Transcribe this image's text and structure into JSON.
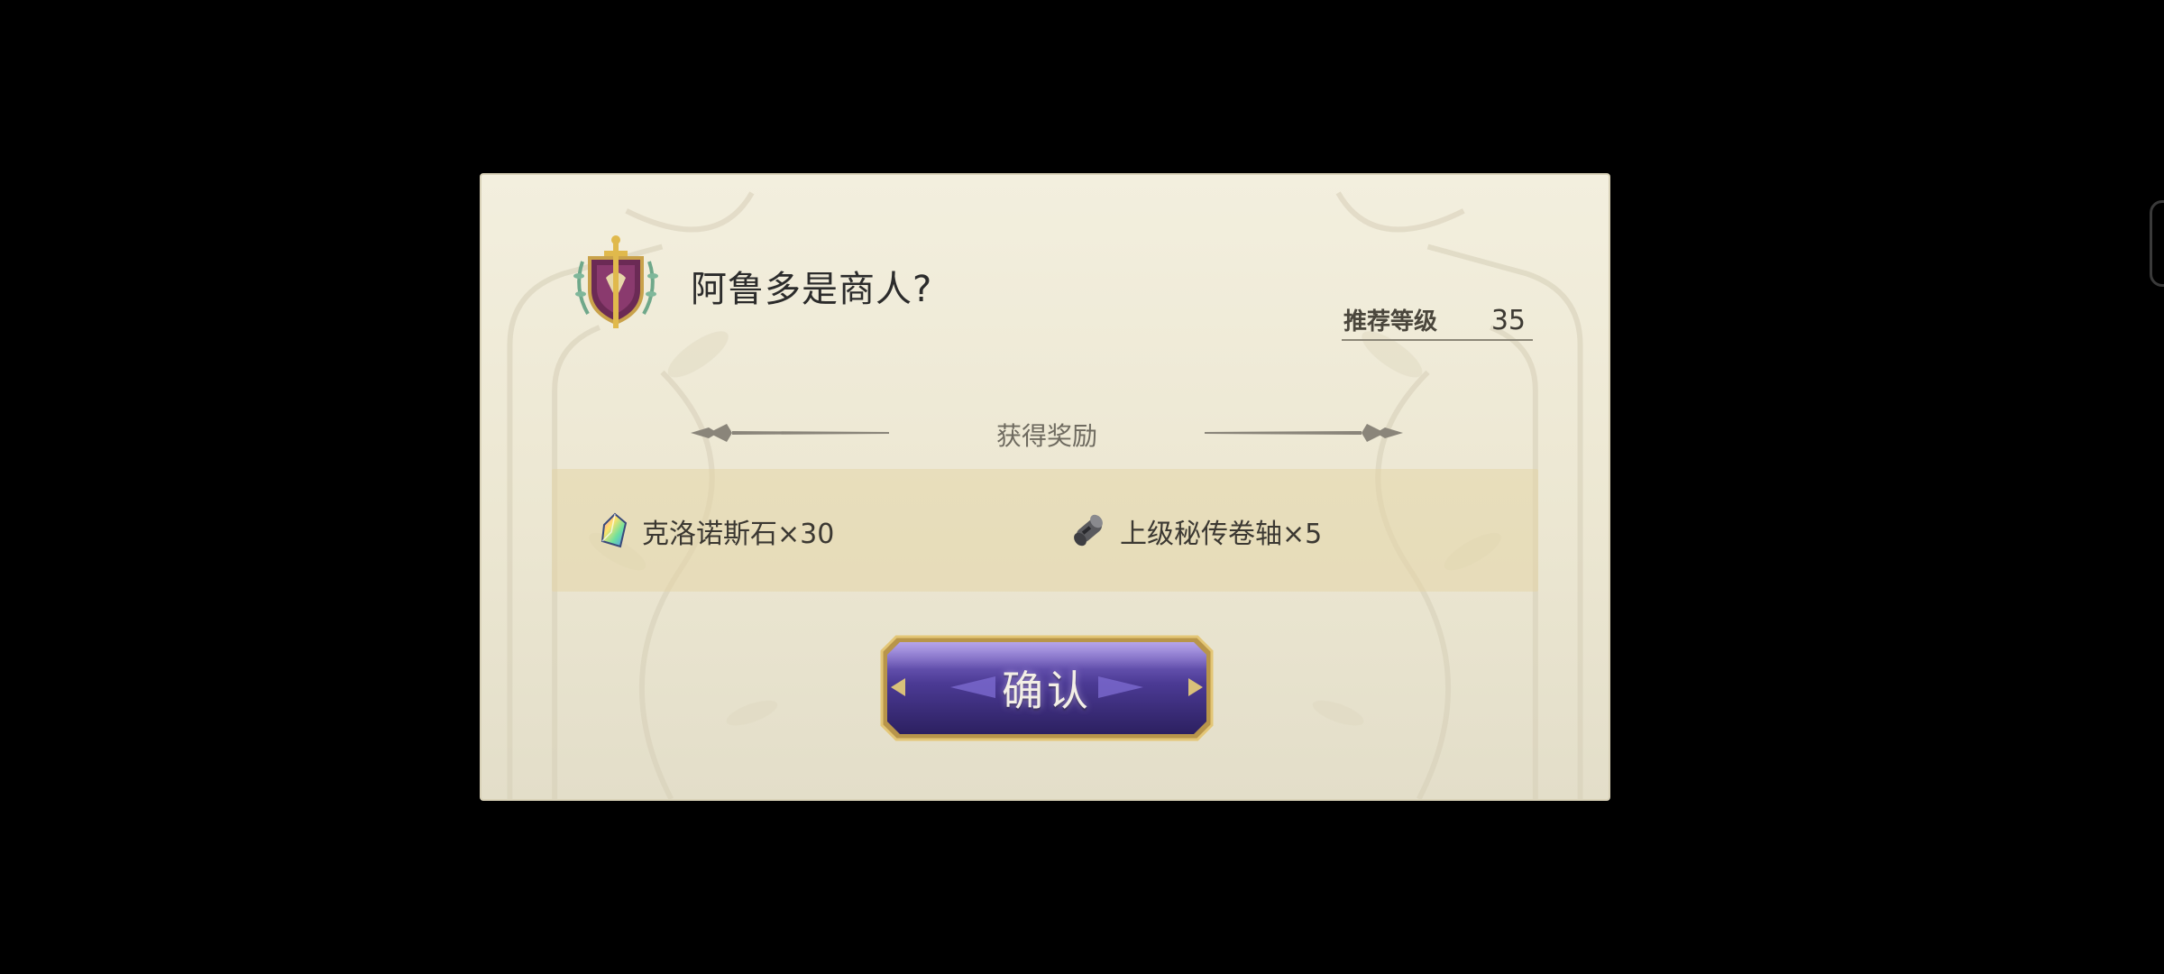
{
  "dialog": {
    "title": "阿鲁多是商人?",
    "emblem_icon": "guild-crest-sword-icon",
    "recommended_level": {
      "label": "推荐等级",
      "value": "35"
    },
    "rewards": {
      "header": "获得奖励",
      "items": [
        {
          "icon": "rainbow-crystal-icon",
          "label": "克洛诺斯石×30"
        },
        {
          "icon": "scroll-icon",
          "label": "上级秘传卷轴×5"
        }
      ]
    },
    "confirm_label": "确认"
  },
  "colors": {
    "background": "#000000",
    "dialog_bg": "#f0ecd9",
    "reward_panel_bg": "#e6d9ad",
    "button_purple": "#4a3a8a",
    "button_border_gold": "#c9a85a"
  }
}
